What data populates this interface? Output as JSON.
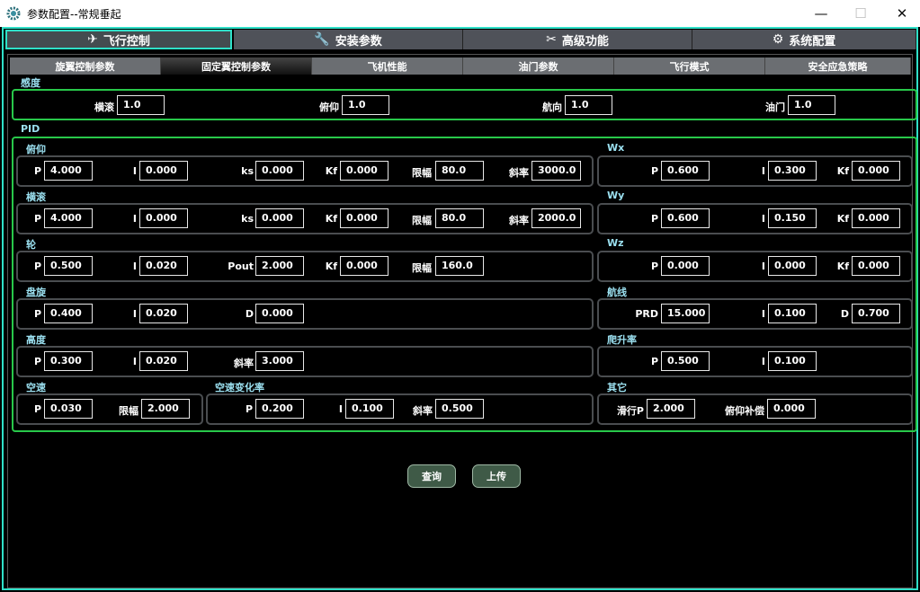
{
  "window": {
    "title": "参数配置--常规垂起"
  },
  "main_tabs": [
    {
      "label": "飞行控制",
      "icon": "drone-icon"
    },
    {
      "label": "安装参数",
      "icon": "wrench-icon"
    },
    {
      "label": "高级功能",
      "icon": "tools-icon"
    },
    {
      "label": "系统配置",
      "icon": "gear-icon"
    }
  ],
  "sub_tabs": [
    "旋翼控制参数",
    "固定翼控制参数",
    "飞机性能",
    "油门参数",
    "飞行模式",
    "安全应急策略"
  ],
  "sensitivity": {
    "title": "感度",
    "roll_label": "横滚",
    "roll": "1.0",
    "pitch_label": "俯仰",
    "pitch": "1.0",
    "yaw_label": "航向",
    "yaw": "1.0",
    "throttle_label": "油门",
    "throttle": "1.0"
  },
  "pid": {
    "title": "PID",
    "pitch": {
      "title": "俯仰",
      "P": "4.000",
      "I": "0.000",
      "ks": "0.000",
      "Kf": "0.000",
      "limit": "80.0",
      "slope": "3000.0"
    },
    "roll": {
      "title": "横滚",
      "P": "4.000",
      "I": "0.000",
      "ks": "0.000",
      "Kf": "0.000",
      "limit": "80.0",
      "slope": "2000.0"
    },
    "wheel": {
      "title": "轮",
      "P": "0.500",
      "I": "0.020",
      "Pout": "2.000",
      "Kf": "0.000",
      "limit": "160.0"
    },
    "circle": {
      "title": "盘旋",
      "P": "0.400",
      "I": "0.020",
      "D": "0.000"
    },
    "altitude": {
      "title": "高度",
      "P": "0.300",
      "I": "0.020",
      "slope": "3.000"
    },
    "airspeed": {
      "title": "空速",
      "P": "0.030",
      "limit": "2.000"
    },
    "airspeed_rate": {
      "title": "空速变化率",
      "P": "0.200",
      "I": "0.100",
      "slope": "0.500"
    },
    "wx": {
      "title": "Wx",
      "P": "0.600",
      "I": "0.300",
      "Kf": "0.000"
    },
    "wy": {
      "title": "Wy",
      "P": "0.600",
      "I": "0.150",
      "Kf": "0.000"
    },
    "wz": {
      "title": "Wz",
      "P": "0.000",
      "I": "0.000",
      "Kf": "0.000"
    },
    "route": {
      "title": "航线",
      "PRD": "15.000",
      "I": "0.100",
      "D": "0.700"
    },
    "climb": {
      "title": "爬升率",
      "P": "0.500",
      "I": "0.100"
    },
    "other": {
      "title": "其它",
      "glide_label": "滑行P",
      "glide": "2.000",
      "pitch_comp_label": "俯仰补偿",
      "pitch_comp": "0.000"
    }
  },
  "labels": {
    "P": "P",
    "I": "I",
    "D": "D",
    "ks": "ks",
    "Kf": "Kf",
    "Pout": "Pout",
    "PRD": "PRD",
    "limit": "限幅",
    "slope": "斜率"
  },
  "buttons": {
    "query": "查询",
    "upload": "上传"
  },
  "colors": {
    "accent": "#2fe0c8",
    "group_border": "#28c84a",
    "label": "#9be0f0",
    "button": "#3f5a47"
  }
}
